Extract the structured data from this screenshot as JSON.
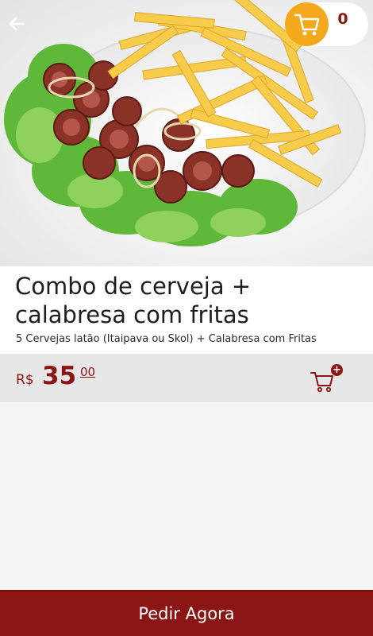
{
  "product": {
    "image_alt": "Combo calabresa com fritas",
    "title": "Combo de cerveja + calabresa com fritas",
    "description": "5 Cervejas latão (Itaipava ou Skol) + Calabresa com Fritas"
  },
  "header": {
    "back_icon": "arrow-left-icon",
    "cart_icon": "shopping-cart-icon",
    "cart_count": "0"
  },
  "price": {
    "currency": "R$",
    "integer": "35",
    "cents": "00"
  },
  "actions": {
    "add_to_cart_icon": "add-to-cart-icon",
    "order_label": "Pedir Agora"
  },
  "colors": {
    "brand": "#8b1515",
    "accent": "#f4a91c"
  }
}
